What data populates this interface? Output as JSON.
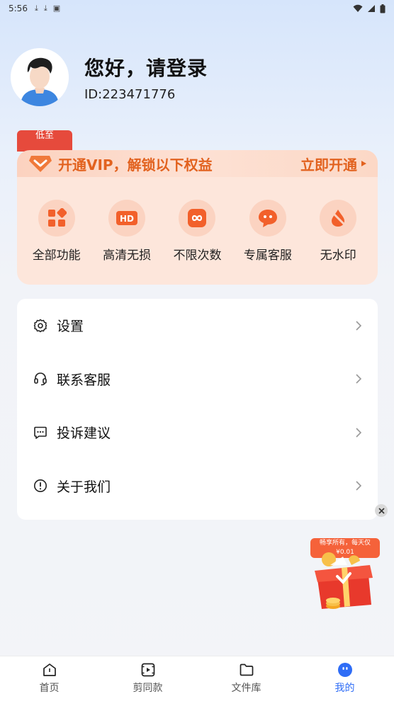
{
  "status_bar": {
    "time": "5:56"
  },
  "profile": {
    "greeting": "您好，请登录",
    "user_id": "ID:223471776"
  },
  "vip": {
    "tag": "低至",
    "title": "开通VIP，解锁以下权益",
    "open_label": "立即开通",
    "items": [
      {
        "label": "全部功能",
        "icon": "grid-icon"
      },
      {
        "label": "高清无损",
        "icon": "hd-icon"
      },
      {
        "label": "不限次数",
        "icon": "infinity-icon"
      },
      {
        "label": "专属客服",
        "icon": "chat-icon"
      },
      {
        "label": "无水印",
        "icon": "watermark-icon"
      }
    ]
  },
  "menu": [
    {
      "label": "设置",
      "icon": "gear-icon"
    },
    {
      "label": "联系客服",
      "icon": "headset-icon"
    },
    {
      "label": "投诉建议",
      "icon": "message-icon"
    },
    {
      "label": "关于我们",
      "icon": "info-icon"
    }
  ],
  "promo": {
    "line1": "畅享所有，每天仅",
    "line2": "¥0.01"
  },
  "nav": [
    {
      "label": "首页",
      "icon": "home-icon"
    },
    {
      "label": "剪同款",
      "icon": "video-template-icon"
    },
    {
      "label": "文件库",
      "icon": "folder-icon"
    },
    {
      "label": "我的",
      "icon": "profile-icon"
    }
  ],
  "colors": {
    "accent": "#2f6df6",
    "vip_orange": "#e2621f",
    "vip_bg": "#fde6db"
  }
}
